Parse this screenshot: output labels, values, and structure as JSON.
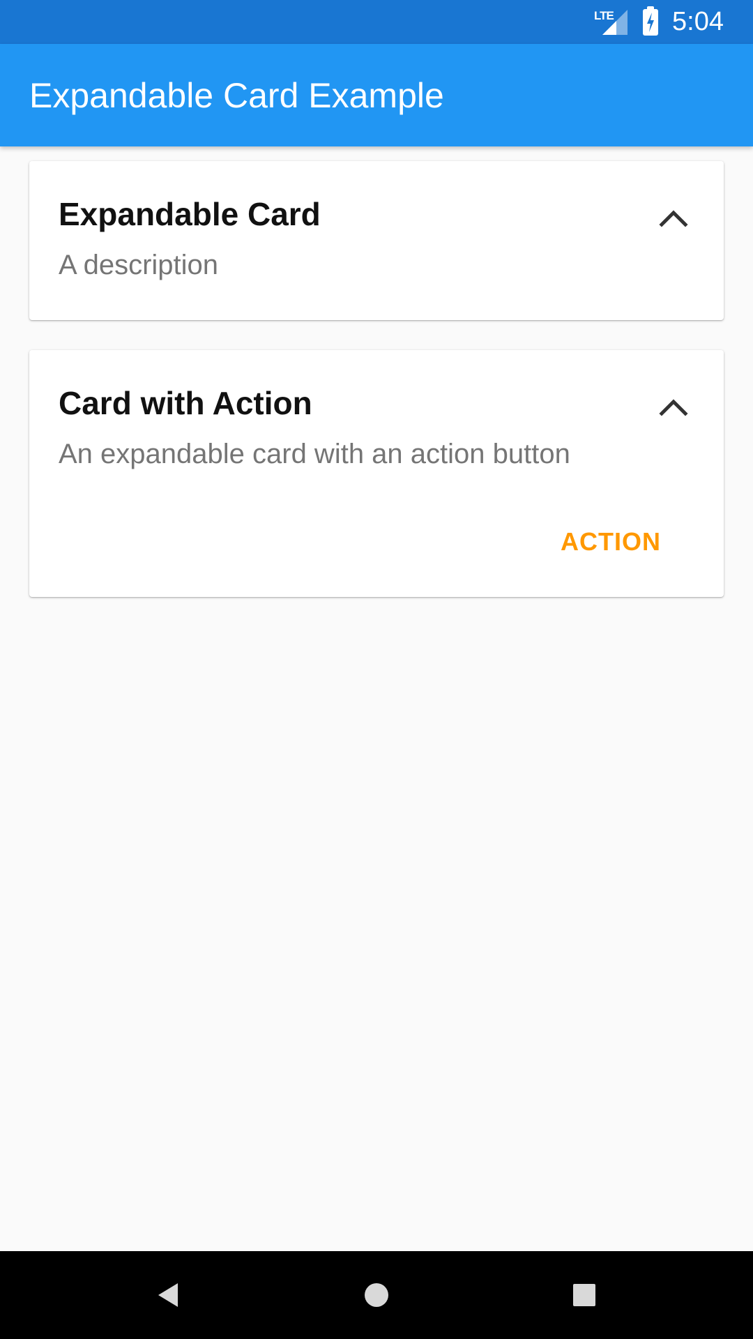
{
  "status_bar": {
    "network": "LTE",
    "time": "5:04",
    "background_color": "#1976d2"
  },
  "app_bar": {
    "title": "Expandable Card Example",
    "background_color": "#2196f3"
  },
  "cards": [
    {
      "title": "Expandable Card",
      "description": "A description",
      "toggle_icon": "chevron-up-icon",
      "expanded": true
    },
    {
      "title": "Card with Action",
      "description": "An expandable card with an action button",
      "toggle_icon": "chevron-up-icon",
      "expanded": true,
      "action_label": "ACTION",
      "action_color": "#ff9800"
    }
  ],
  "nav_bar": {
    "buttons": [
      "back-icon",
      "home-icon",
      "recents-icon"
    ]
  }
}
